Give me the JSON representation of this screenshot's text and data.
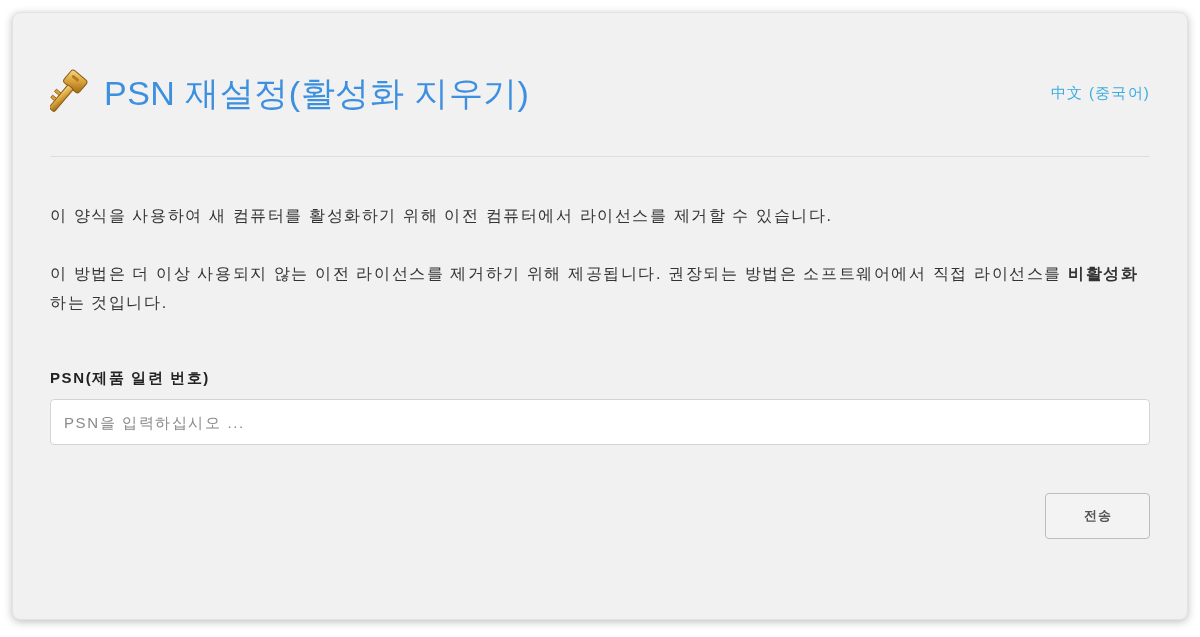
{
  "header": {
    "title": "PSN 재설정(활성화 지우기)",
    "language_link": "中文 (중국어)"
  },
  "paragraphs": [
    "이 양식을 사용하여 새 컴퓨터를 활성화하기 위해 이전 컴퓨터에서 라이선스를 제거할 수 있습니다.",
    "이 방법은 더 이상 사용되지 않는 이전 라이선스를 제거하기 위해 제공됩니다. 권장되는 방법은 소프트웨어에서 직접 라이선스를 **비활성화**하는 것입니다."
  ],
  "form": {
    "label": "PSN(제품 일련 번호)",
    "placeholder": "PSN을 입력하십시오 ...",
    "submit": "전송"
  }
}
